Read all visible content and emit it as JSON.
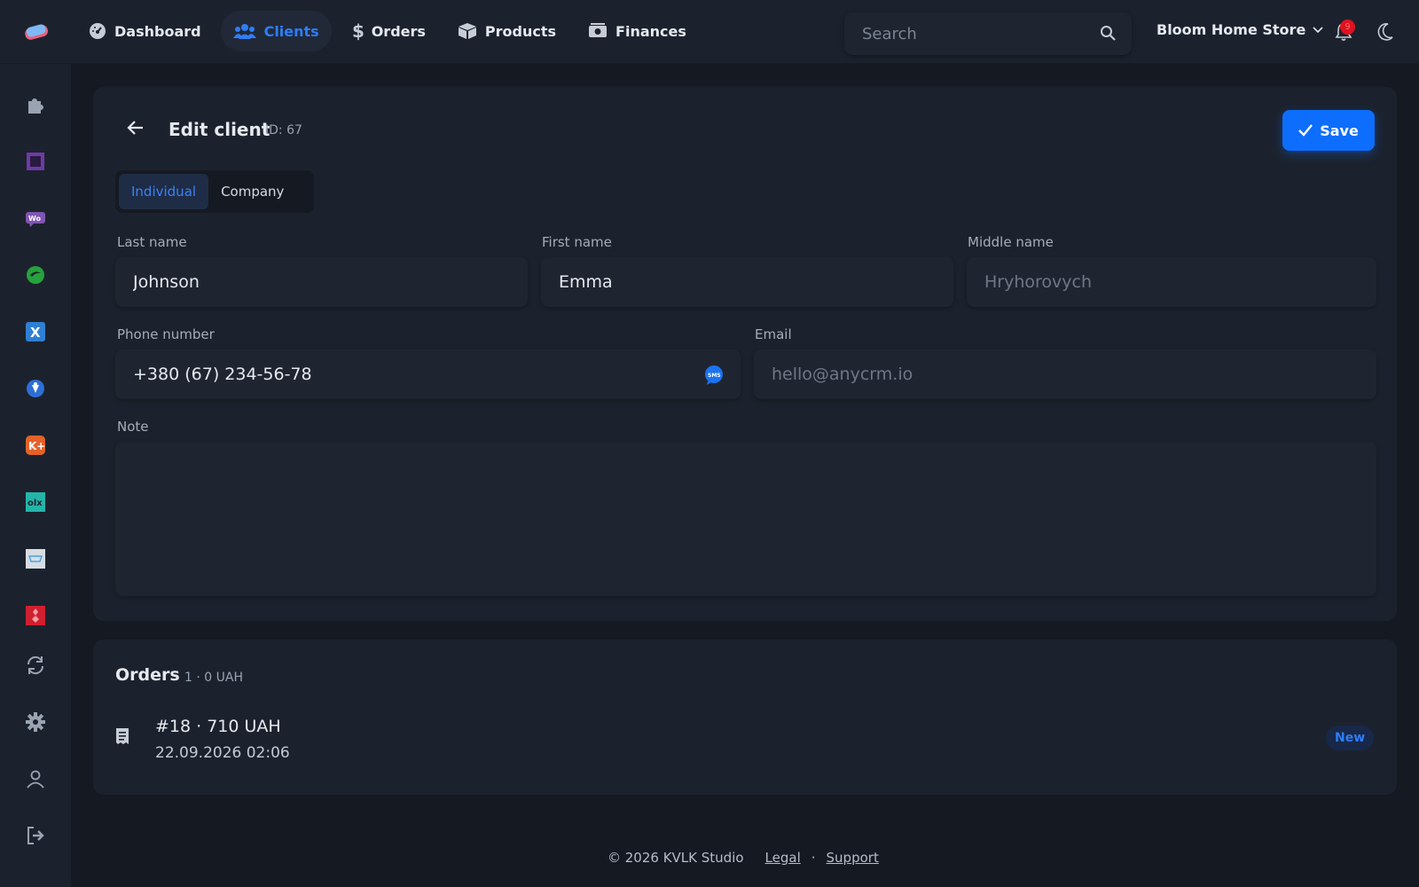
{
  "nav": {
    "items": [
      {
        "label": "Dashboard",
        "icon": "gauge-icon"
      },
      {
        "label": "Clients",
        "icon": "users-icon",
        "active": true
      },
      {
        "label": "Orders",
        "icon": "dollar-icon"
      },
      {
        "label": "Products",
        "icon": "box-icon"
      },
      {
        "label": "Finances",
        "icon": "money-icon"
      }
    ]
  },
  "search": {
    "placeholder": "Search"
  },
  "store": {
    "name": "Bloom Home Store"
  },
  "notifications": {
    "count": "9"
  },
  "sidebar": {
    "icons": [
      "puzzle-icon",
      "square-app-icon",
      "woo-app-icon",
      "green-app-icon",
      "x-app-icon",
      "shield-app-icon",
      "k-app-icon",
      "olx-app-icon",
      "cart-app-icon",
      "red-app-icon",
      "sync-icon",
      "gear-icon",
      "user-icon",
      "logout-icon"
    ]
  },
  "edit": {
    "title": "Edit client",
    "id_label": "ID: 67",
    "save_label": "Save",
    "tabs": [
      "Individual",
      "Company"
    ],
    "active_tab": "Individual",
    "last_name": {
      "label": "Last name",
      "value": "Johnson"
    },
    "first_name": {
      "label": "First name",
      "value": "Emma"
    },
    "middle_name": {
      "label": "Middle name",
      "placeholder": "Hryhorovych"
    },
    "phone": {
      "label": "Phone number",
      "value": "+380 (67) 234-56-78"
    },
    "email": {
      "label": "Email",
      "placeholder": "hello@anycrm.io"
    },
    "note": {
      "label": "Note",
      "value": ""
    }
  },
  "orders": {
    "title": "Orders",
    "meta": "1 · 0 UAH",
    "items": [
      {
        "line1": "#18 · 710 UAH",
        "line2": "22.09.2026 02:06",
        "status": "New"
      }
    ]
  },
  "footer": {
    "copyright": "© 2026 KVLK Studio",
    "legal": "Legal",
    "separator": "·",
    "support": "Support"
  },
  "colors": {
    "accent": "#0d6efd",
    "background": "#141922",
    "surface": "#1c222d"
  }
}
